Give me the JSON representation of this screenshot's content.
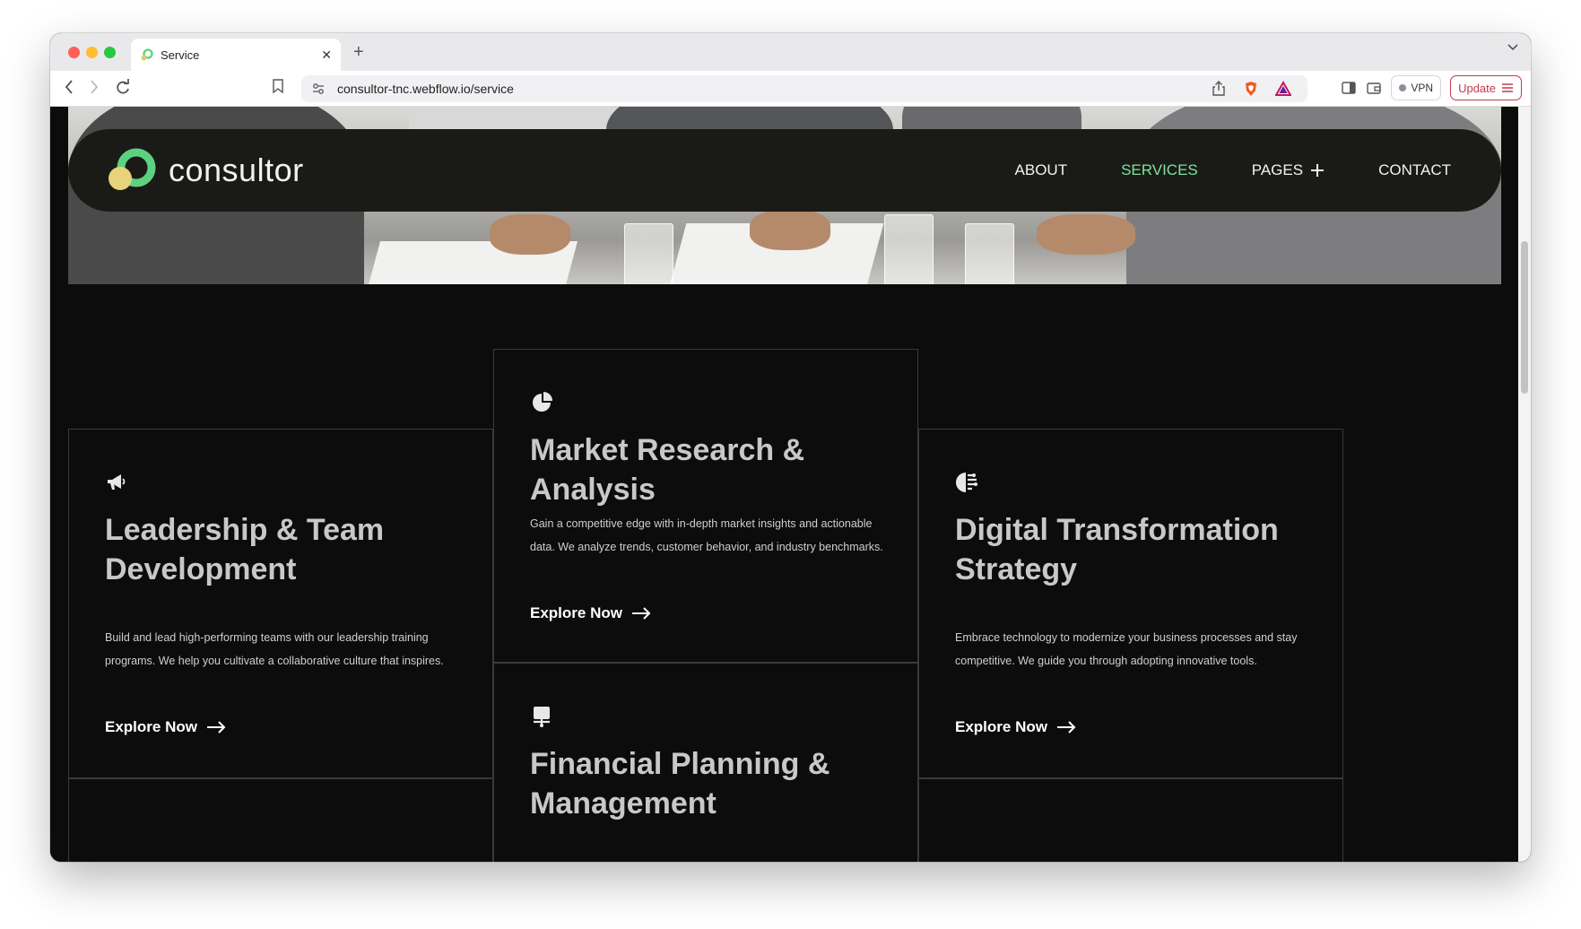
{
  "browser": {
    "tab_title": "Service",
    "tab_close": "✕",
    "new_tab": "+",
    "url": "consultor-tnc.webflow.io/service",
    "vpn_label": "VPN",
    "update_label": "Update"
  },
  "site": {
    "logo_text": "consultor",
    "nav": {
      "about": "ABOUT",
      "services": "SERVICES",
      "pages": "PAGES",
      "contact": "CONTACT"
    },
    "accent_color": "#7ee39a"
  },
  "services": [
    {
      "icon": "megaphone-icon",
      "title": "Leadership & Team Development",
      "description": "Build and lead high-performing teams with our leadership training programs. We help you cultivate a collaborative culture that inspires.",
      "link": "Explore Now"
    },
    {
      "icon": "pie-chart-icon",
      "title": "Market Research & Analysis",
      "description": "Gain a competitive edge with in-depth market insights and actionable data. We analyze trends, customer behavior, and industry benchmarks.",
      "link": "Explore Now"
    },
    {
      "icon": "digital-brain-icon",
      "title": "Digital Transformation Strategy",
      "description": "Embrace technology to modernize your business processes and stay competitive. We guide you through adopting innovative tools.",
      "link": "Explore Now"
    },
    {
      "icon": "presentation-icon",
      "title": "Financial Planning & Management"
    }
  ]
}
